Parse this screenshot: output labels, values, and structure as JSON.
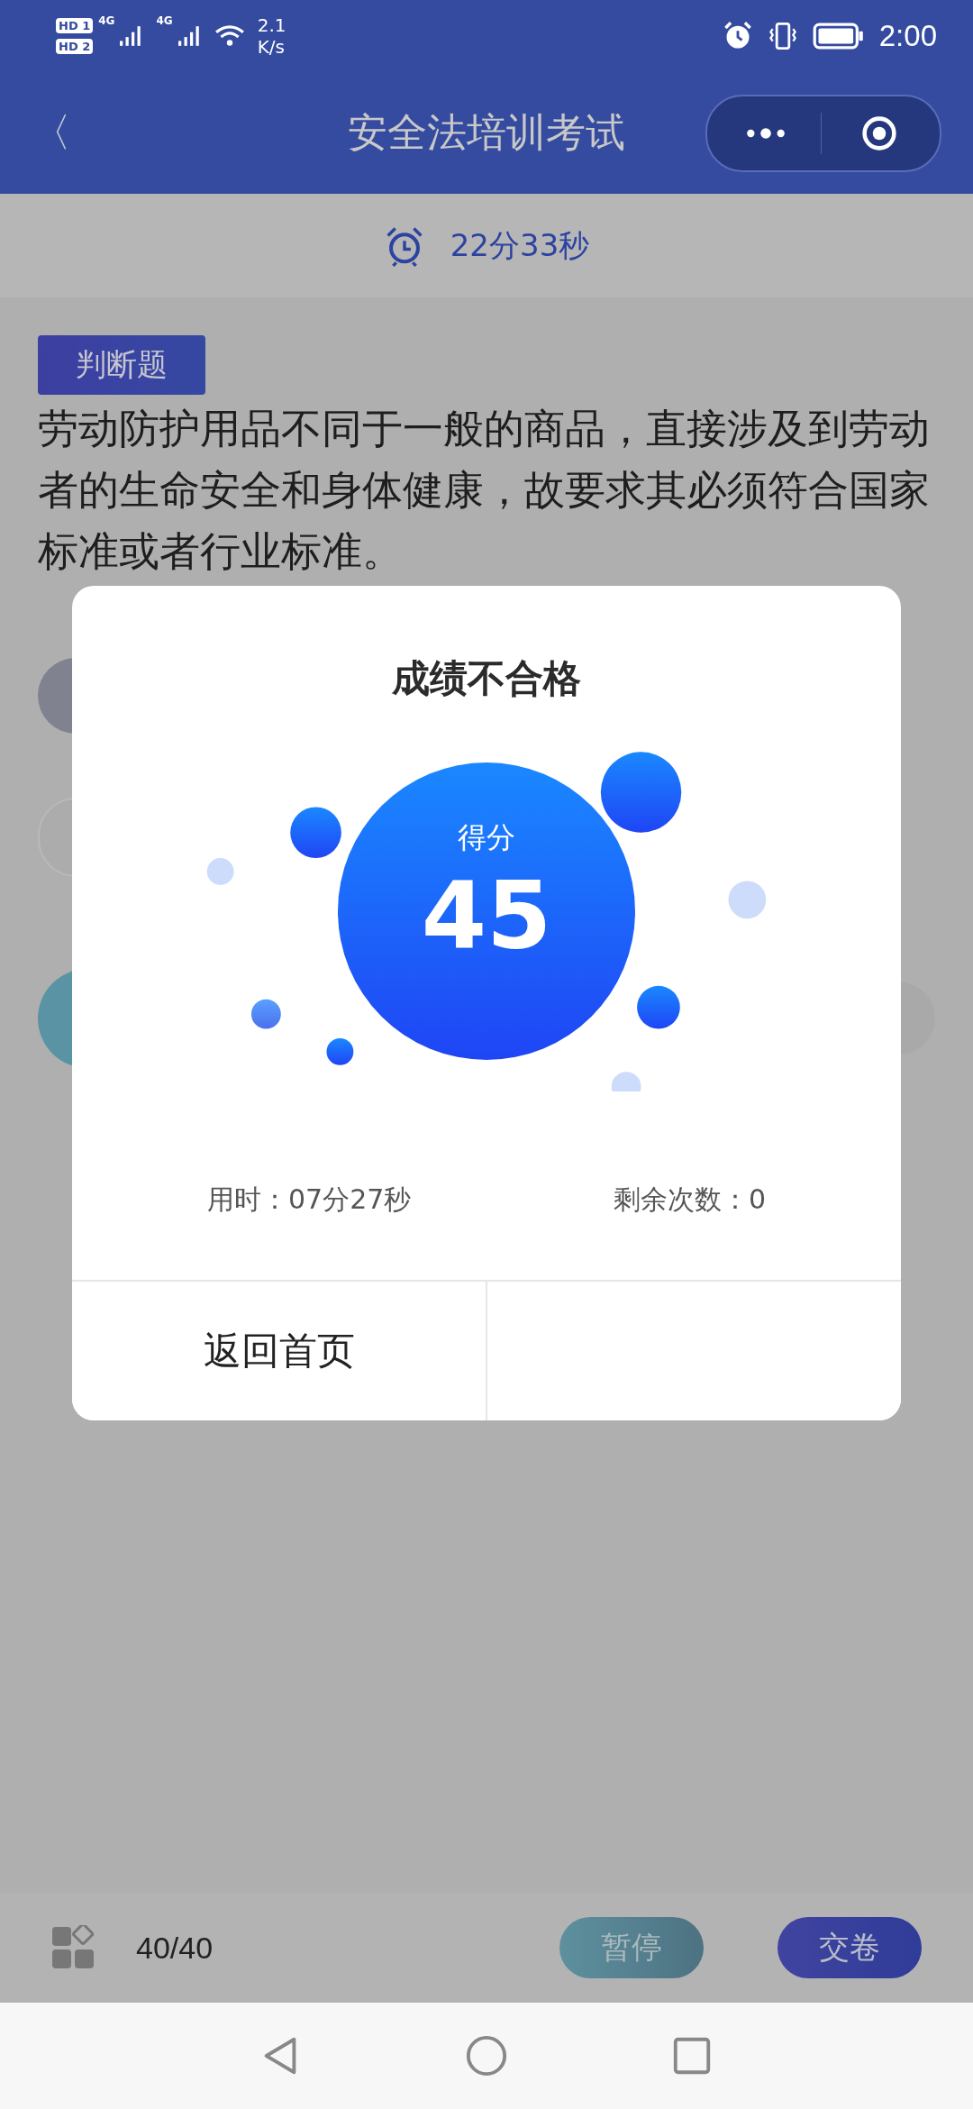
{
  "status_bar": {
    "sim1": "HD 1",
    "sim2": "HD 2",
    "net1": "4G",
    "net2": "4G",
    "speed": "2.1",
    "speed_unit": "K/s",
    "time": "2:00"
  },
  "nav": {
    "back": "〈",
    "title": "安全法培训考试"
  },
  "timer": {
    "text": "22分33秒"
  },
  "question": {
    "type_label": "判断题",
    "text": "劳动防护用品不同于一般的商品，直接涉及到劳动者的生命安全和身体健康，故要求其必须符合国家标准或者行业标准。"
  },
  "dialog": {
    "title": "成绩不合格",
    "score_label": "得分",
    "score": "45",
    "time_used": "用时：07分27秒",
    "attempts_left": "剩余次数：0",
    "home_button": "返回首页"
  },
  "bottom_bar": {
    "progress": "40/40",
    "pause": "暂停",
    "submit": "交卷"
  }
}
